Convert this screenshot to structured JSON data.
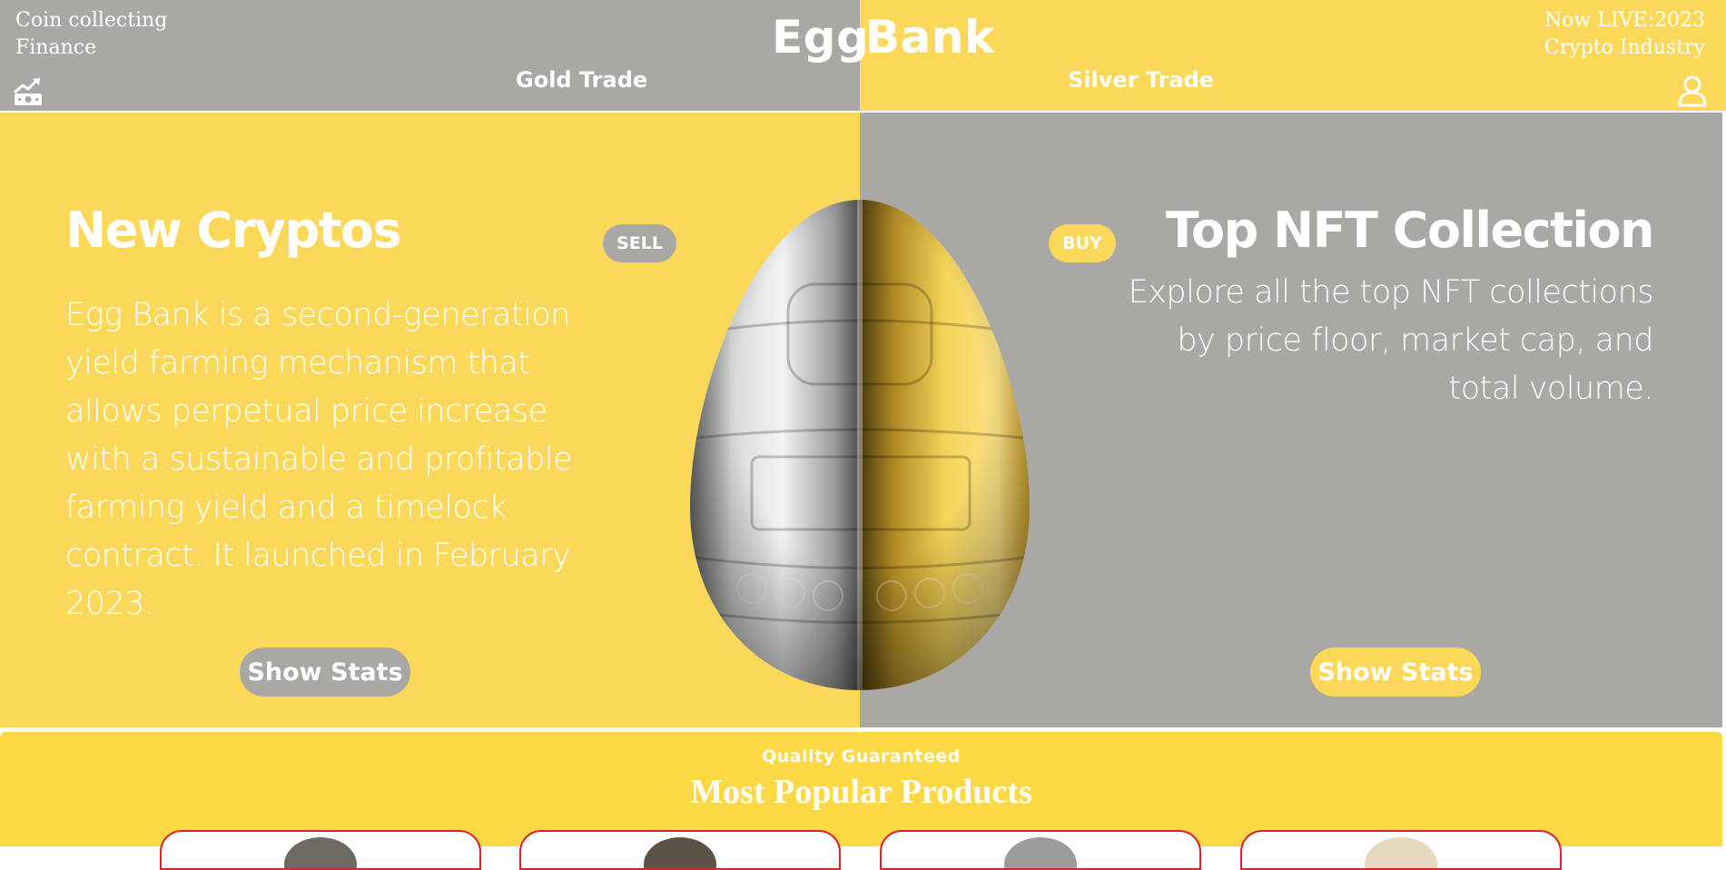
{
  "header": {
    "top_left_line1": "Coin collecting",
    "top_left_line2": "Finance",
    "logo_part1": "Egg",
    "logo_part2": "Bank",
    "top_right_line1": "Now LIVE:2023",
    "top_right_line2": "Crypto Industry",
    "nav_gold": "Gold Trade",
    "nav_silver": "Silver Trade",
    "left_icon": "chart-money-icon",
    "right_icon": "user-icon"
  },
  "hero": {
    "left": {
      "title": "New Cryptos",
      "text": "Egg Bank is a second-generation yield farming mechanism that allows perpetual price increase with a sustainable and profitable farming yield and a timelock contract. It launched in February 2023.",
      "badge": "SELL",
      "button": "Show Stats"
    },
    "right": {
      "title": "Top NFT Collection",
      "text": "Explore all the top NFT collections by price floor, market cap, and total volume.",
      "badge": "BUY",
      "button": "Show Stats"
    },
    "image": "silver-gold-egg-coin"
  },
  "products": {
    "eyebrow": "Quality Guaranteed",
    "title": "Most Popular Products"
  },
  "colors": {
    "gray": "#a9a8a5",
    "yellow": "#fcd85a",
    "band_yellow": "#fcd844",
    "card_border": "#d9242b"
  }
}
